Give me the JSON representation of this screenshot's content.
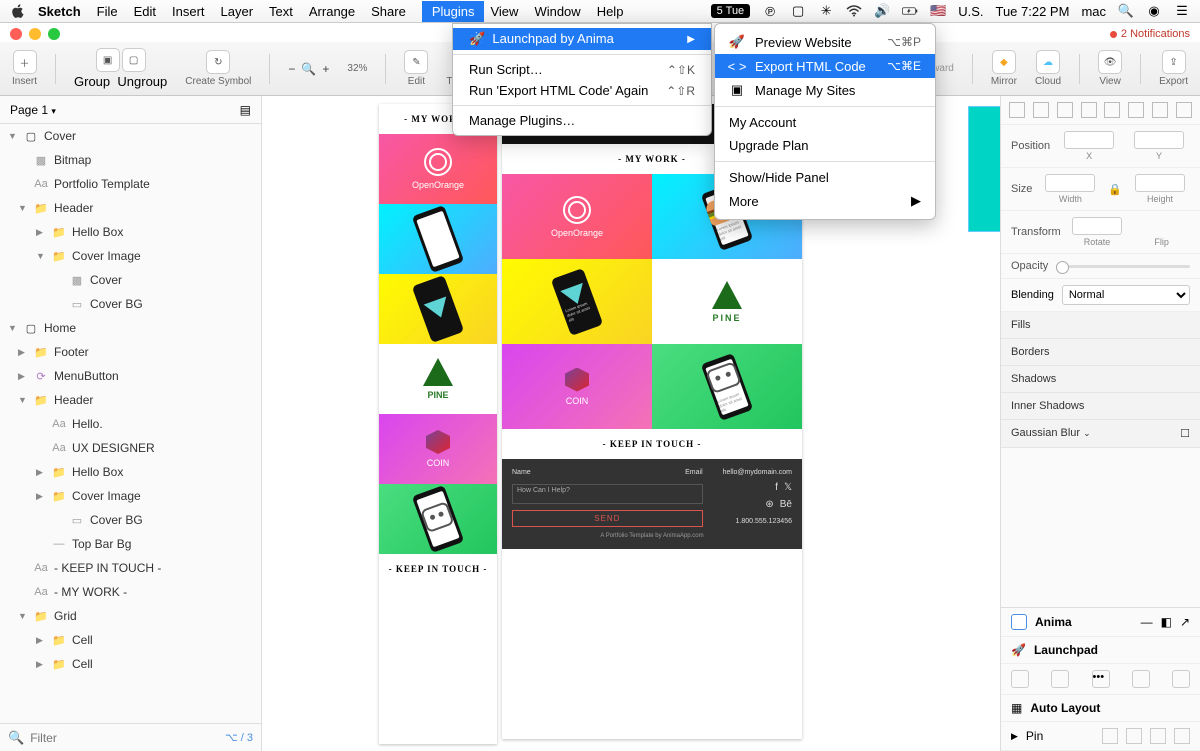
{
  "menubar": {
    "app": "Sketch",
    "items": [
      "File",
      "Edit",
      "Insert",
      "Layer",
      "Text",
      "Arrange",
      "Share",
      "Plugins",
      "View",
      "Window",
      "Help"
    ],
    "active": "Plugins",
    "tue": "5 Tue",
    "locale": "U.S.",
    "clock": "Tue 7:22 PM",
    "user": "mac"
  },
  "notifications": "2 Notifications",
  "plugins_menu": {
    "launchpad": "Launchpad by Anima",
    "items": [
      {
        "label": "Run Script…",
        "shortcut": "⌃⇧K"
      },
      {
        "label": "Run 'Export HTML Code' Again",
        "shortcut": "⌃⇧R"
      },
      {
        "label": "Manage Plugins…",
        "shortcut": ""
      }
    ]
  },
  "submenu": {
    "items1": [
      {
        "icon": "rocket",
        "label": "Preview Website",
        "shortcut": "⌥⌘P"
      },
      {
        "icon": "code",
        "label": "Export HTML Code",
        "shortcut": "⌥⌘E",
        "selected": true
      },
      {
        "icon": "window",
        "label": "Manage My Sites",
        "shortcut": ""
      }
    ],
    "items2": [
      {
        "label": "My Account"
      },
      {
        "label": "Upgrade Plan"
      }
    ],
    "items3": [
      {
        "label": "Show/Hide Panel"
      },
      {
        "label": "More",
        "arrow": true
      }
    ]
  },
  "toolbar": {
    "insert": "Insert",
    "group": "Group",
    "ungroup": "Ungroup",
    "create_symbol": "Create Symbol",
    "zoom": "32%",
    "edit": "Edit",
    "transform": "Transform",
    "forward": "kward",
    "mirror": "Mirror",
    "cloud": "Cloud",
    "view": "View",
    "export": "Export"
  },
  "pages": {
    "current": "Page 1"
  },
  "layers": [
    {
      "d": 0,
      "tri": "▼",
      "ico": "artboard",
      "txt": "Cover"
    },
    {
      "d": 1,
      "tri": "",
      "ico": "bitmap",
      "txt": "Bitmap"
    },
    {
      "d": 1,
      "tri": "",
      "ico": "text",
      "txt": "Portfolio Template"
    },
    {
      "d": 1,
      "tri": "▼",
      "ico": "folder",
      "txt": "Header"
    },
    {
      "d": 2,
      "tri": "▶",
      "ico": "folder",
      "txt": "Hello Box"
    },
    {
      "d": 2,
      "tri": "▼",
      "ico": "folder",
      "txt": "Cover Image"
    },
    {
      "d": 3,
      "tri": "",
      "ico": "bitmap",
      "txt": "Cover"
    },
    {
      "d": 3,
      "tri": "",
      "ico": "rect",
      "txt": "Cover BG"
    },
    {
      "d": 0,
      "tri": "▼",
      "ico": "artboard",
      "txt": "Home"
    },
    {
      "d": 1,
      "tri": "▶",
      "ico": "folder",
      "txt": "Footer"
    },
    {
      "d": 1,
      "tri": "▶",
      "ico": "symbol",
      "txt": "MenuButton"
    },
    {
      "d": 1,
      "tri": "▼",
      "ico": "folder",
      "txt": "Header"
    },
    {
      "d": 2,
      "tri": "",
      "ico": "text",
      "txt": "Hello."
    },
    {
      "d": 2,
      "tri": "",
      "ico": "text",
      "txt": "UX DESIGNER"
    },
    {
      "d": 2,
      "tri": "▶",
      "ico": "folder",
      "txt": "Hello Box"
    },
    {
      "d": 2,
      "tri": "▶",
      "ico": "folder",
      "txt": "Cover Image"
    },
    {
      "d": 3,
      "tri": "",
      "ico": "rect",
      "txt": "Cover BG"
    },
    {
      "d": 2,
      "tri": "",
      "ico": "line",
      "txt": "Top Bar Bg"
    },
    {
      "d": 1,
      "tri": "",
      "ico": "text",
      "txt": "- KEEP IN TOUCH -"
    },
    {
      "d": 1,
      "tri": "",
      "ico": "text",
      "txt": "- MY WORK -"
    },
    {
      "d": 1,
      "tri": "▼",
      "ico": "folder",
      "txt": "Grid"
    },
    {
      "d": 2,
      "tri": "▶",
      "ico": "folder",
      "txt": "Cell"
    },
    {
      "d": 2,
      "tri": "▶",
      "ico": "folder",
      "txt": "Cell"
    }
  ],
  "filter": {
    "placeholder": "Filter",
    "meta": "⌥ / 3"
  },
  "artboard": {
    "mywork": "- MY WORK -",
    "keepintouch": "- KEEP IN TOUCH -",
    "openorange": "OpenOrange",
    "pine": "PINE",
    "coin": "COIN",
    "name": "Name",
    "email": "Email",
    "help": "How Can I Help?",
    "send": "SEND",
    "hello": "hello@mydomain.com",
    "phone": "1.800.555.123456",
    "credit": "A Portfolio Template by AnimaApp.com",
    "lorem": "Lorem ipsum dolor sit amet elit"
  },
  "inspector": {
    "position": "Position",
    "x": "X",
    "y": "Y",
    "size": "Size",
    "width": "Width",
    "height": "Height",
    "transform": "Transform",
    "rotate": "Rotate",
    "flip": "Flip",
    "opacity": "Opacity",
    "blending": "Blending",
    "blend_value": "Normal",
    "fills": "Fills",
    "borders": "Borders",
    "shadows": "Shadows",
    "inner_shadows": "Inner Shadows",
    "gaussian": "Gaussian Blur"
  },
  "plugins_panel": {
    "anima": "Anima",
    "launchpad": "Launchpad",
    "autolayout": "Auto Layout",
    "pin": "Pin"
  }
}
